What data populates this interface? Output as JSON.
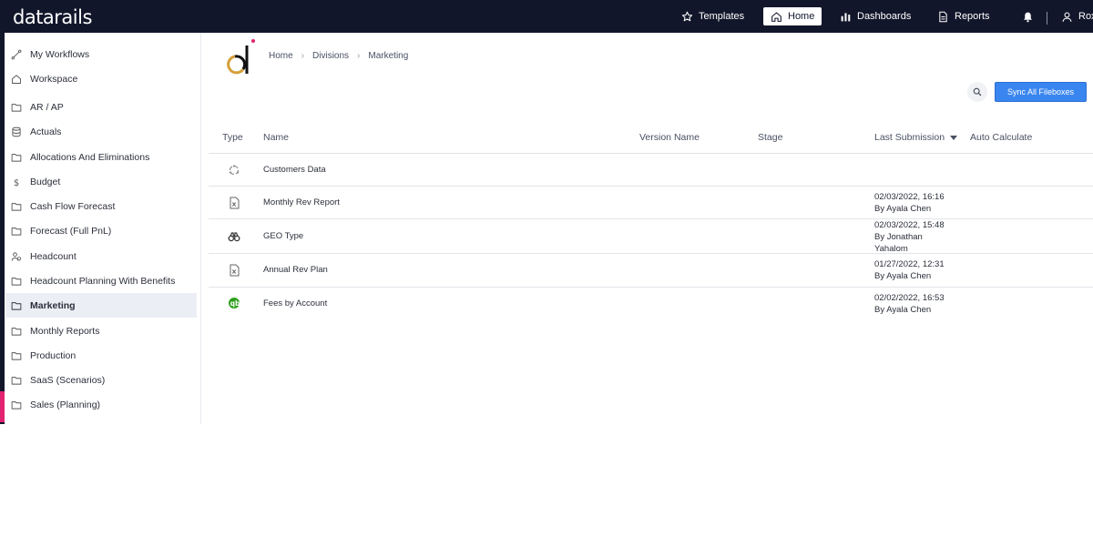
{
  "app": {
    "logo": "datarails"
  },
  "topnav": {
    "templates": "Templates",
    "home": "Home",
    "dashboards": "Dashboards",
    "reports": "Reports",
    "user": "Roxa"
  },
  "sidebar": {
    "items": [
      {
        "label": "My Workflows",
        "icon": "workflow-icon"
      },
      {
        "label": "Workspace",
        "icon": "home-icon"
      },
      {
        "label": "AR / AP",
        "icon": "folder-icon"
      },
      {
        "label": "Actuals",
        "icon": "database-icon"
      },
      {
        "label": "Allocations And Eliminations",
        "icon": "folder-icon"
      },
      {
        "label": "Budget",
        "icon": "dollar-icon"
      },
      {
        "label": "Cash Flow Forecast",
        "icon": "folder-icon"
      },
      {
        "label": "Forecast (Full PnL)",
        "icon": "folder-icon"
      },
      {
        "label": "Headcount",
        "icon": "people-icon"
      },
      {
        "label": "Headcount Planning With Benefits",
        "icon": "folder-icon"
      },
      {
        "label": "Marketing",
        "icon": "folder-icon",
        "active": true
      },
      {
        "label": "Monthly Reports",
        "icon": "folder-icon"
      },
      {
        "label": "Production",
        "icon": "folder-icon"
      },
      {
        "label": "SaaS (Scenarios)",
        "icon": "folder-icon"
      },
      {
        "label": "Sales (Planning)",
        "icon": "folder-icon"
      }
    ]
  },
  "breadcrumb": [
    "Home",
    "Divisions",
    "Marketing"
  ],
  "actions": {
    "sync_label": "Sync All Fileboxes"
  },
  "table": {
    "columns": [
      "Type",
      "Name",
      "Version Name",
      "Stage",
      "Last Submission",
      "Auto Calculate"
    ],
    "rows": [
      {
        "icon": "cycle-icon",
        "name": "Customers Data",
        "submission": []
      },
      {
        "icon": "excel-file-icon",
        "name": "Monthly Rev Report",
        "submission": [
          "02/03/2022, 16:16",
          "By Ayala Chen"
        ]
      },
      {
        "icon": "binoculars-icon",
        "name": "GEO Type",
        "submission": [
          "02/03/2022, 15:48",
          "By Jonathan",
          "Yahalom"
        ]
      },
      {
        "icon": "excel-file-icon",
        "name": "Annual Rev Plan",
        "submission": [
          "01/27/2022, 12:31",
          "By Ayala Chen"
        ]
      },
      {
        "icon": "quickbooks-icon",
        "name": "Fees by Account",
        "submission": [
          "02/02/2022, 16:53",
          "By Ayala Chen"
        ]
      }
    ]
  },
  "colors": {
    "topbar": "#12162b",
    "accent": "#3a86f0",
    "active_row": "#eceef6",
    "quickbooks": "#2ca01c"
  }
}
